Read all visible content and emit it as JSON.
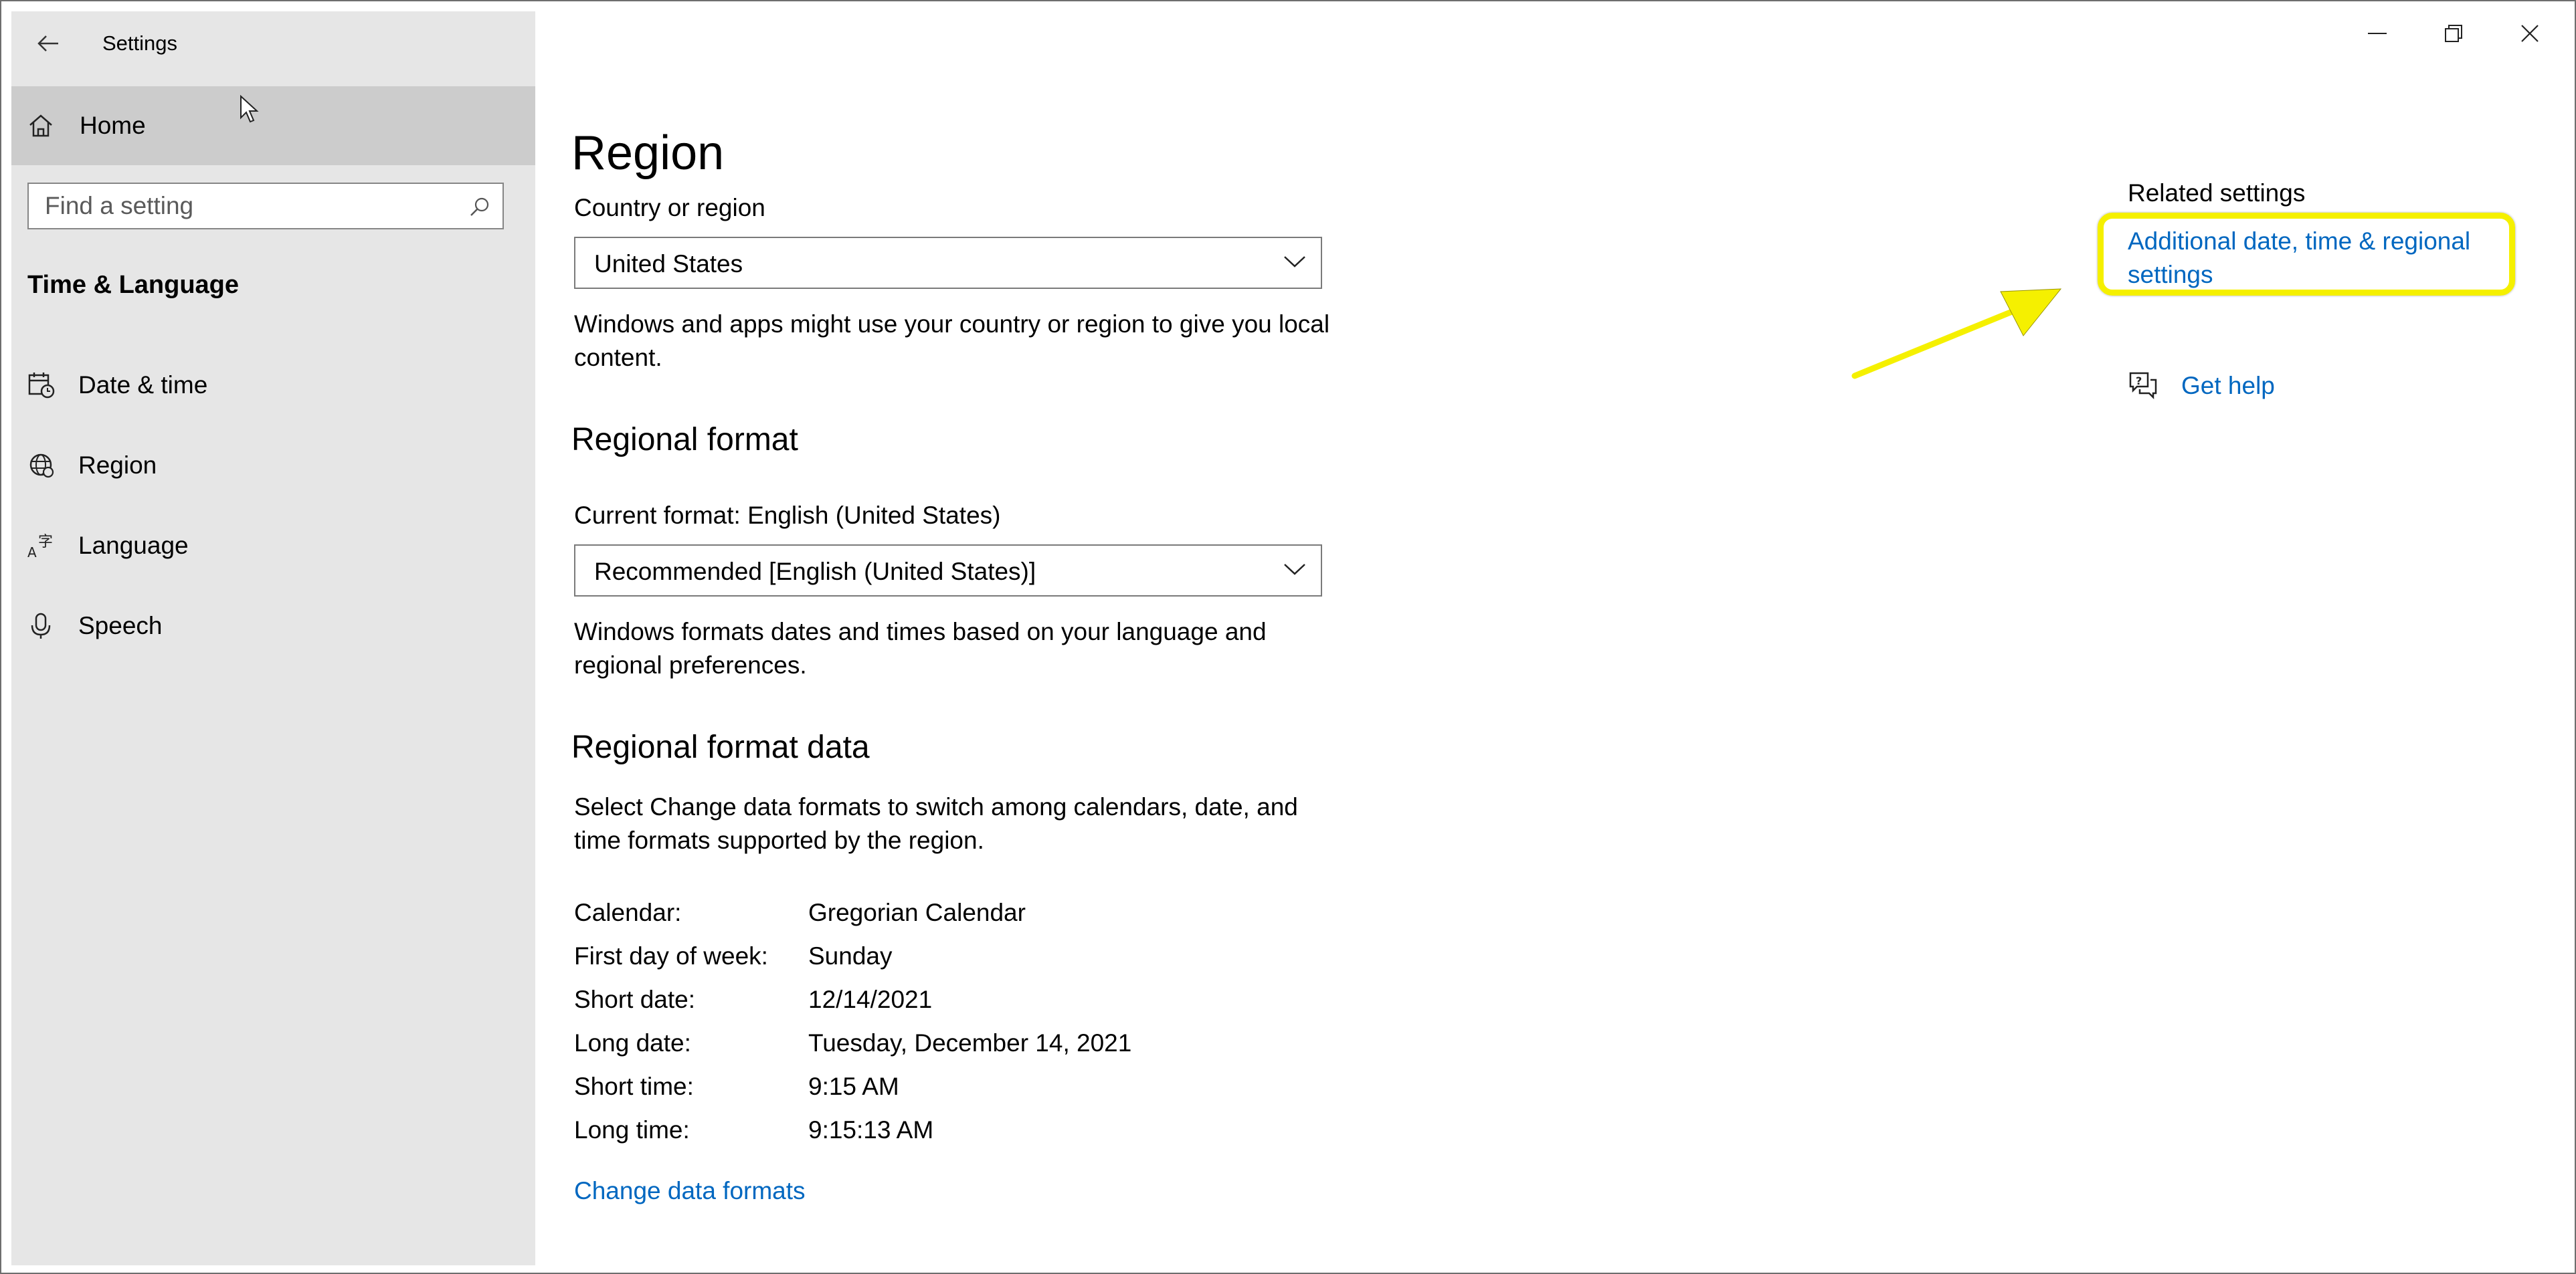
{
  "window": {
    "title": "Settings",
    "controls": {
      "minimize": "minimize",
      "maximize": "restore",
      "close": "close"
    }
  },
  "sidebar": {
    "home_label": "Home",
    "search_placeholder": "Find a setting",
    "group_title": "Time & Language",
    "items": [
      {
        "label": "Date & time",
        "icon": "calendar-clock-icon"
      },
      {
        "label": "Region",
        "icon": "globe-icon"
      },
      {
        "label": "Language",
        "icon": "language-icon"
      },
      {
        "label": "Speech",
        "icon": "microphone-icon"
      }
    ]
  },
  "main": {
    "title": "Region",
    "country": {
      "label": "Country or region",
      "value": "United States",
      "description": "Windows and apps might use your country or region to give you local content."
    },
    "regional_format": {
      "title": "Regional format",
      "current_label": "Current format: English (United States)",
      "value": "Recommended [English (United States)]",
      "description": "Windows formats dates and times based on your language and regional preferences."
    },
    "format_data": {
      "title": "Regional format data",
      "description": "Select Change data formats to switch among calendars, date, and time formats supported by the region.",
      "rows": [
        {
          "key": "Calendar:",
          "value": "Gregorian Calendar"
        },
        {
          "key": "First day of week:",
          "value": "Sunday"
        },
        {
          "key": "Short date:",
          "value": "12/14/2021"
        },
        {
          "key": "Long date:",
          "value": "Tuesday, December 14, 2021"
        },
        {
          "key": "Short time:",
          "value": "9:15 AM"
        },
        {
          "key": "Long time:",
          "value": "9:15:13 AM"
        }
      ],
      "change_link": "Change data formats"
    }
  },
  "related": {
    "title": "Related settings",
    "link": "Additional date, time & regional settings",
    "help": "Get help"
  },
  "colors": {
    "accent": "#0067c0",
    "sidebar_bg": "#e6e6e6",
    "selected_bg": "#cccccc",
    "highlight": "#f5f000"
  }
}
